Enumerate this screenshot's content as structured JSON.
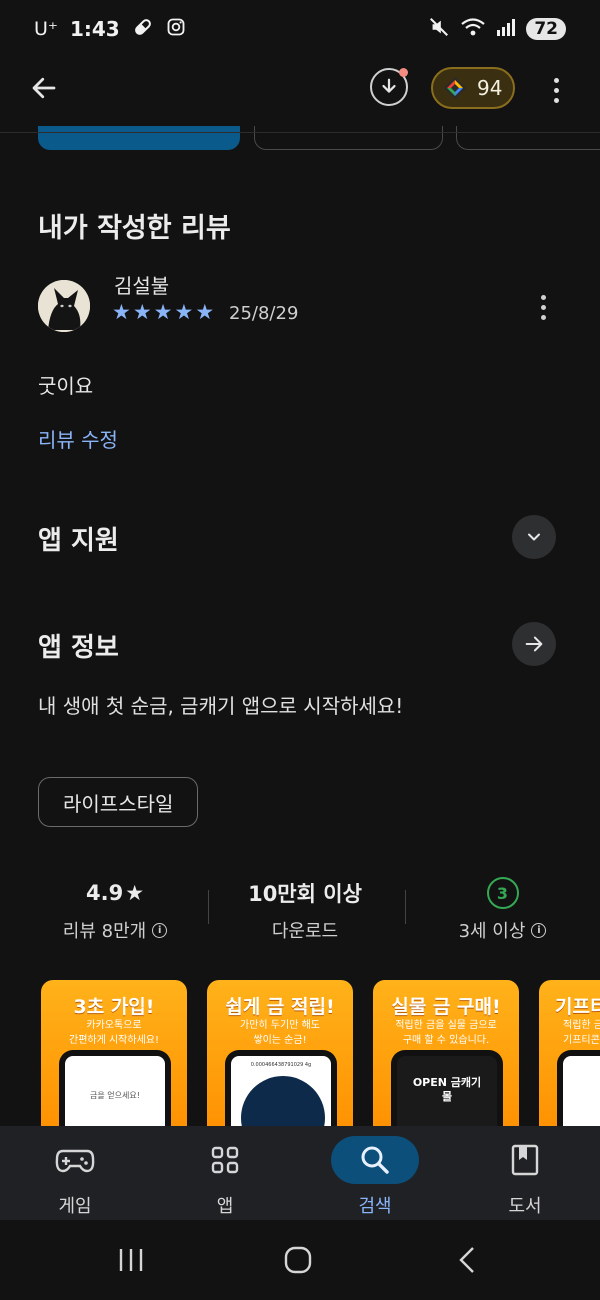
{
  "status_bar": {
    "carrier": "U⁺",
    "time": "1:43",
    "battery": "72"
  },
  "app_bar": {
    "points": "94"
  },
  "review_section": {
    "title": "내가 작성한 리뷰",
    "reviewer": "김설불",
    "rating": 5,
    "date": "25/8/29",
    "body": "굿이요",
    "edit_link": "리뷰 수정"
  },
  "support_section": {
    "title": "앱 지원"
  },
  "info_section": {
    "title": "앱 정보",
    "description": "내 생애 첫 순금, 금캐기 앱으로 시작하세요!",
    "category": "라이프스타일"
  },
  "stats": {
    "rating_value": "4.9",
    "rating_star": "★",
    "rating_label": "리뷰 8만개",
    "downloads_value": "10만회 이상",
    "downloads_label": "다운로드",
    "age_value": "3",
    "age_label": "3세 이상"
  },
  "screenshots": [
    {
      "title": "3초 가입!",
      "subtitle_1": "카카오톡으로",
      "subtitle_2": "간편하게 시작하세요!",
      "screen_text": "금을 얻으세요!"
    },
    {
      "title": "쉽게 금 적립!",
      "subtitle_1": "가만히 두기만 해도",
      "subtitle_2": "쌓이는 순금!",
      "screen_text": "0.000466438791029 4g"
    },
    {
      "title": "실물 금 구매!",
      "subtitle_1": "적립한 금을 실물 금으로",
      "subtitle_2": "구매 할 수 있습니다.",
      "screen_text": "OPEN 금캐기 몰"
    },
    {
      "title": "기프티",
      "subtitle_1": "적립한 금",
      "subtitle_2": "기프티콘",
      "screen_text": ""
    }
  ],
  "bottom_nav": [
    {
      "label": "게임",
      "icon": "gamepad-icon"
    },
    {
      "label": "앱",
      "icon": "apps-grid-icon"
    },
    {
      "label": "검색",
      "icon": "search-icon",
      "active": true
    },
    {
      "label": "도서",
      "icon": "book-icon"
    }
  ],
  "colors": {
    "background": "#121212",
    "accent": "#8ab4f8",
    "active_nav": "#0b4f7a",
    "age_badge": "#34a853",
    "screenshot_orange": "#ff9f0a"
  }
}
